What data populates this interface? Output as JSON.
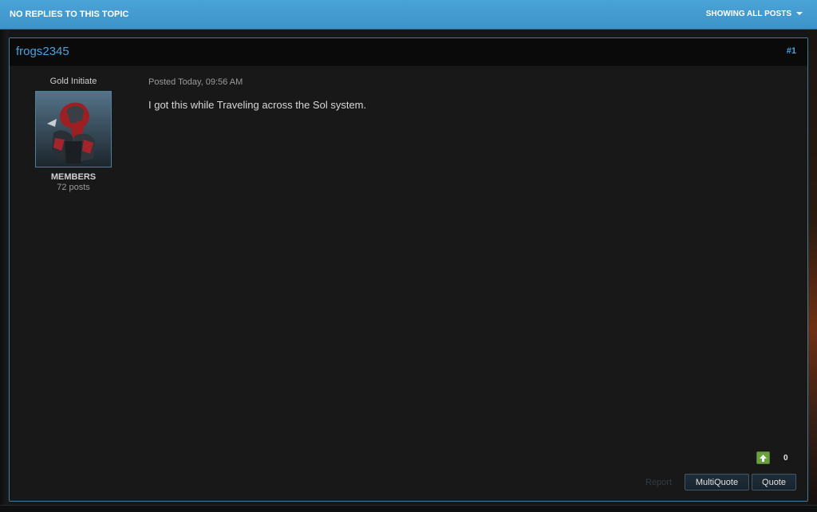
{
  "topbar": {
    "title": "NO REPLIES TO THIS TOPIC",
    "filter_label": "SHOWING ALL POSTS"
  },
  "post": {
    "author": "frogs2345",
    "number": "#1",
    "rank": "Gold Initiate",
    "group": "MEMBERS",
    "post_count": "72 posts",
    "posted": "Posted Today, 09:56 AM",
    "body": "I got this while Traveling across the Sol system.",
    "reputation": "0"
  },
  "actions": {
    "report": "Report",
    "multiquote": "MultiQuote",
    "quote": "Quote"
  },
  "colors": {
    "accent": "#4aa3dd",
    "header_bar": "#3d93c9",
    "rep_green": "#69a13e"
  },
  "icons": {
    "filter_caret": "chevron-down-icon",
    "rep_up": "arrow-up-icon"
  }
}
